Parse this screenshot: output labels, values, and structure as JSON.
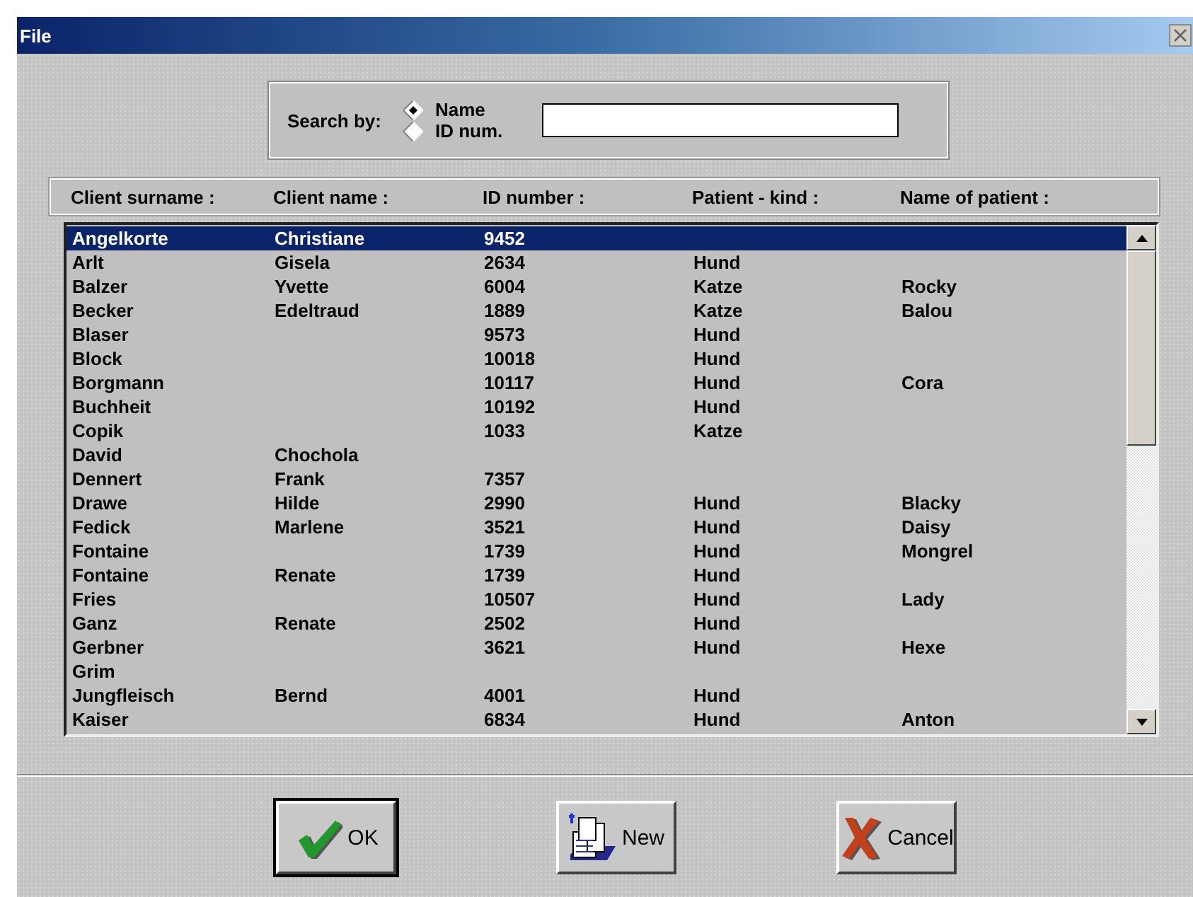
{
  "window": {
    "title": "File"
  },
  "search": {
    "label": "Search by:",
    "options": [
      {
        "label": "Name",
        "selected": true
      },
      {
        "label": "ID num.",
        "selected": false
      }
    ]
  },
  "table": {
    "columns": [
      "Client surname :",
      "Client name :",
      "ID number :",
      "Patient - kind :",
      "Name of patient :"
    ],
    "rows": [
      {
        "cells": [
          "Angelkorte",
          "Christiane",
          "9452",
          "",
          ""
        ],
        "selected": true
      },
      {
        "cells": [
          "Arlt",
          "Gisela",
          "2634",
          "Hund",
          ""
        ],
        "selected": false
      },
      {
        "cells": [
          "Balzer",
          "Yvette",
          "6004",
          "Katze",
          "Rocky"
        ],
        "selected": false
      },
      {
        "cells": [
          "Becker",
          "Edeltraud",
          "1889",
          "Katze",
          "Balou"
        ],
        "selected": false
      },
      {
        "cells": [
          "Blaser",
          "",
          "9573",
          "Hund",
          ""
        ],
        "selected": false
      },
      {
        "cells": [
          "Block",
          "",
          "10018",
          "Hund",
          ""
        ],
        "selected": false
      },
      {
        "cells": [
          "Borgmann",
          "",
          "10117",
          "Hund",
          "Cora"
        ],
        "selected": false
      },
      {
        "cells": [
          "Buchheit",
          "",
          "10192",
          "Hund",
          ""
        ],
        "selected": false
      },
      {
        "cells": [
          "Copik",
          "",
          "1033",
          "Katze",
          ""
        ],
        "selected": false
      },
      {
        "cells": [
          "David",
          "Chochola",
          "",
          "",
          ""
        ],
        "selected": false
      },
      {
        "cells": [
          "Dennert",
          "Frank",
          "7357",
          "",
          ""
        ],
        "selected": false
      },
      {
        "cells": [
          "Drawe",
          "Hilde",
          "2990",
          "Hund",
          "Blacky"
        ],
        "selected": false
      },
      {
        "cells": [
          "Fedick",
          "Marlene",
          "3521",
          "Hund",
          "Daisy"
        ],
        "selected": false
      },
      {
        "cells": [
          "Fontaine",
          "",
          "1739",
          "Hund",
          "Mongrel"
        ],
        "selected": false
      },
      {
        "cells": [
          "Fontaine",
          "Renate",
          "1739",
          "Hund",
          ""
        ],
        "selected": false
      },
      {
        "cells": [
          "Fries",
          "",
          "10507",
          "Hund",
          "Lady"
        ],
        "selected": false
      },
      {
        "cells": [
          "Ganz",
          "Renate",
          "2502",
          "Hund",
          ""
        ],
        "selected": false
      },
      {
        "cells": [
          "Gerbner",
          "",
          "3621",
          "Hund",
          "Hexe"
        ],
        "selected": false
      },
      {
        "cells": [
          "Grim",
          "",
          "",
          "",
          ""
        ],
        "selected": false
      },
      {
        "cells": [
          "Jungfleisch",
          "Bernd",
          "4001",
          "Hund",
          ""
        ],
        "selected": false
      },
      {
        "cells": [
          "Kaiser",
          "",
          "6834",
          "Hund",
          "Anton"
        ],
        "selected": false
      }
    ]
  },
  "buttons": [
    {
      "label": "OK",
      "kind": "ok",
      "default": true
    },
    {
      "label": "New",
      "kind": "new",
      "default": false
    },
    {
      "label": "Cancel",
      "kind": "cancel",
      "default": false
    }
  ]
}
